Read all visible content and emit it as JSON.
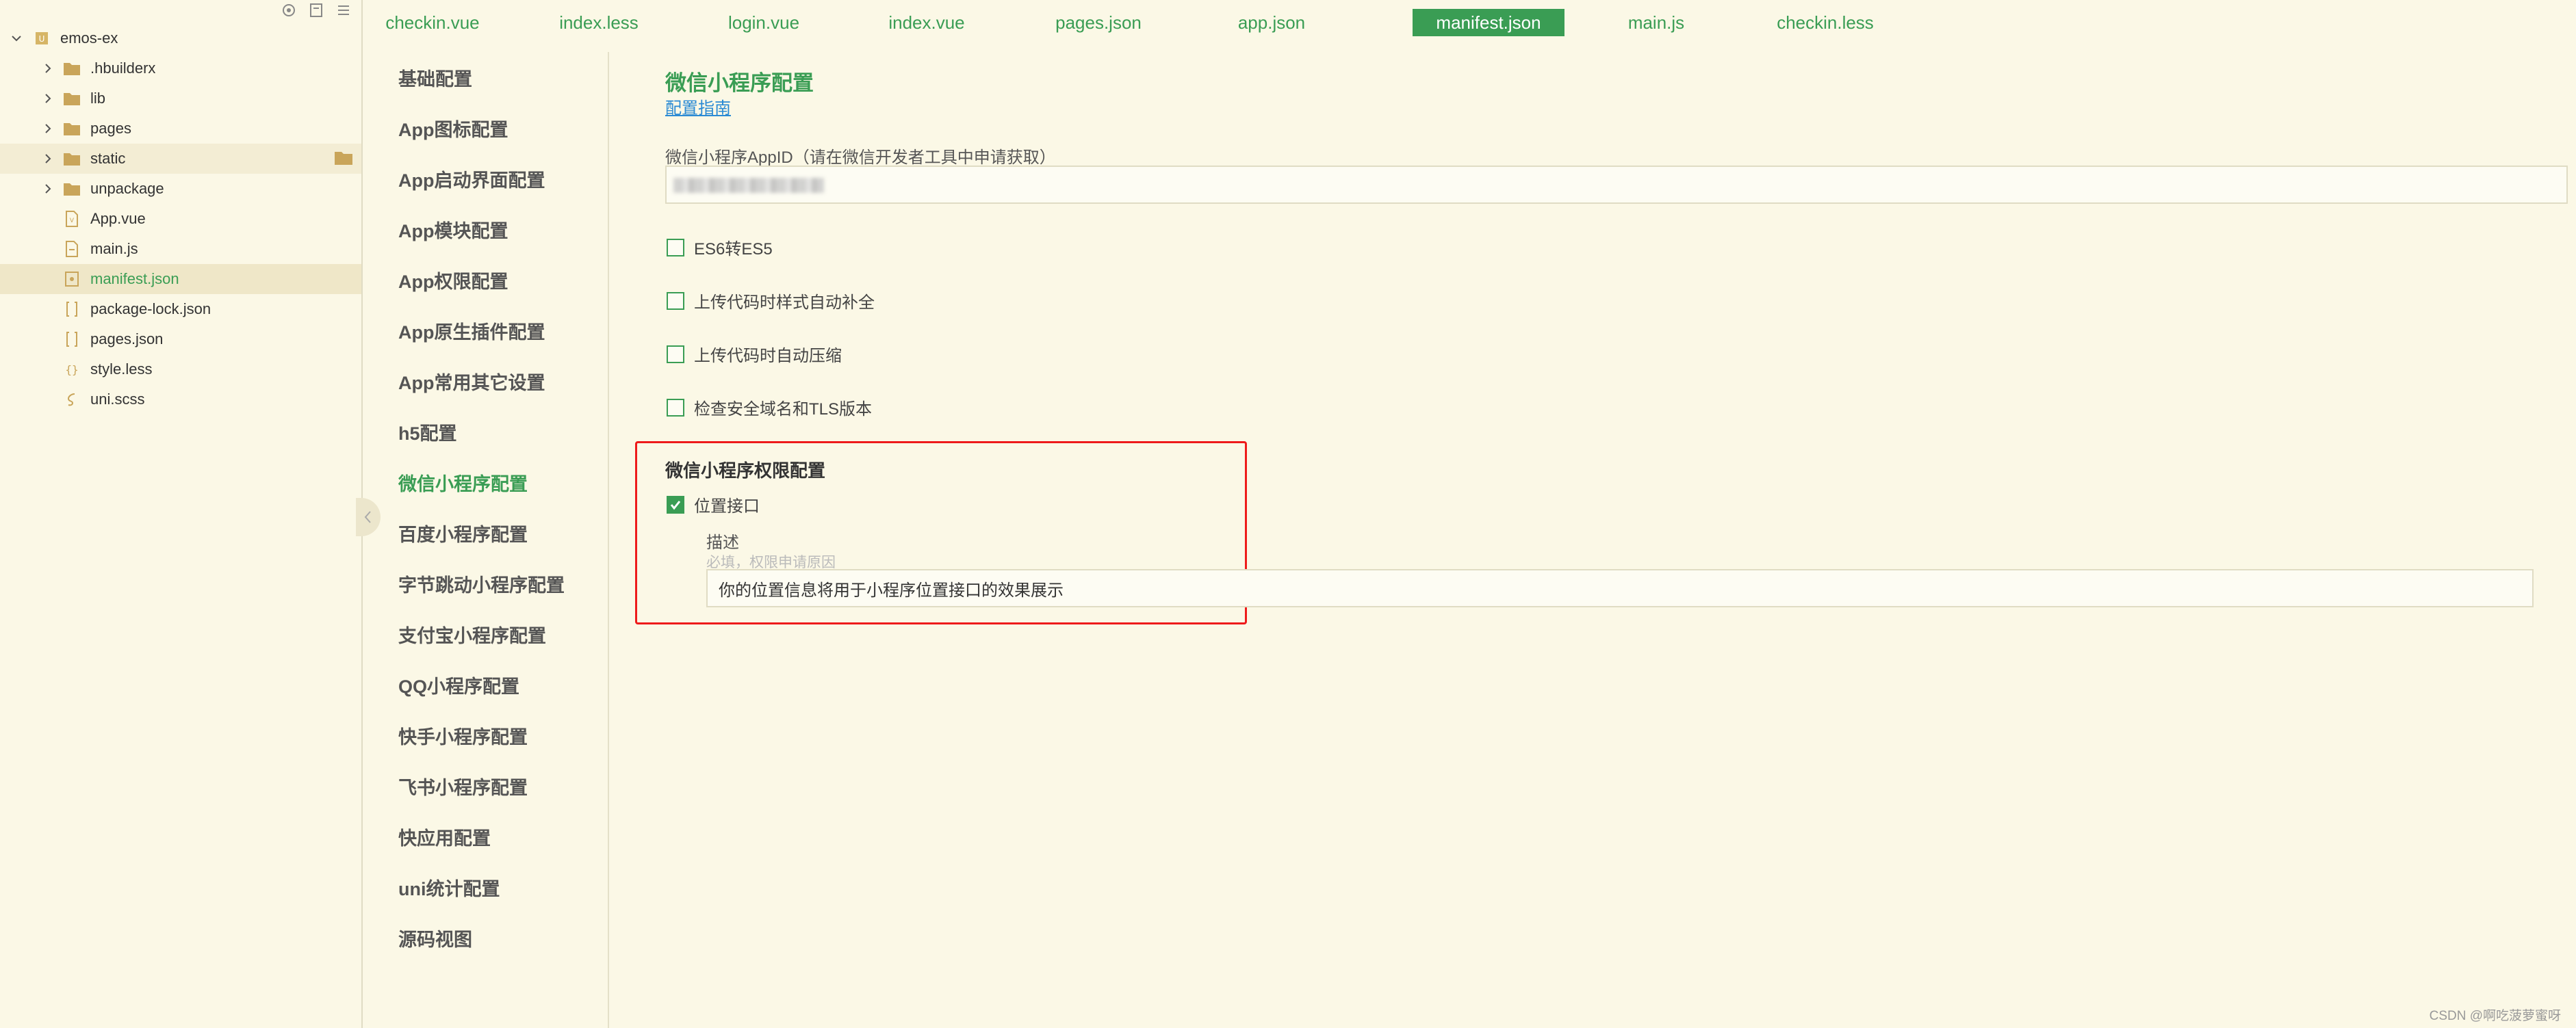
{
  "explorer": {
    "toolbar_icons": [
      "locate-icon",
      "new-file-icon",
      "menu-icon"
    ],
    "project": "emos-ex",
    "items": [
      {
        "label": ".hbuilderx",
        "type": "folder"
      },
      {
        "label": "lib",
        "type": "folder"
      },
      {
        "label": "pages",
        "type": "folder"
      },
      {
        "label": "static",
        "type": "folder"
      },
      {
        "label": "unpackage",
        "type": "folder"
      },
      {
        "label": "App.vue",
        "type": "vue"
      },
      {
        "label": "main.js",
        "type": "js"
      },
      {
        "label": "manifest.json",
        "type": "json",
        "active": true
      },
      {
        "label": "package-lock.json",
        "type": "json"
      },
      {
        "label": "pages.json",
        "type": "json"
      },
      {
        "label": "style.less",
        "type": "less"
      },
      {
        "label": "uni.scss",
        "type": "scss"
      }
    ]
  },
  "tabs": [
    "checkin.vue",
    "index.less",
    "login.vue",
    "index.vue",
    "pages.json",
    "app.json",
    "manifest.json",
    "main.js",
    "checkin.less"
  ],
  "active_tab": "manifest.json",
  "nav": {
    "items": [
      "基础配置",
      "App图标配置",
      "App启动界面配置",
      "App模块配置",
      "App权限配置",
      "App原生插件配置",
      "App常用其它设置",
      "h5配置",
      "微信小程序配置",
      "百度小程序配置",
      "字节跳动小程序配置",
      "支付宝小程序配置",
      "QQ小程序配置",
      "快手小程序配置",
      "飞书小程序配置",
      "快应用配置",
      "uni统计配置",
      "源码视图"
    ],
    "active": "微信小程序配置"
  },
  "content": {
    "title": "微信小程序配置",
    "guide_link": "配置指南",
    "appid_label": "微信小程序AppID（请在微信开发者工具中申请获取）",
    "options": [
      {
        "label": "ES6转ES5",
        "checked": false
      },
      {
        "label": "上传代码时样式自动补全",
        "checked": false
      },
      {
        "label": "上传代码时自动压缩",
        "checked": false
      },
      {
        "label": "检查安全域名和TLS版本",
        "checked": false
      }
    ],
    "permission": {
      "title": "微信小程序权限配置",
      "location_label": "位置接口",
      "location_checked": true,
      "desc_label": "描述",
      "desc_hint": "必填，权限申请原因",
      "desc_value": "你的位置信息将用于小程序位置接口的效果展示"
    }
  },
  "watermark": "CSDN @啊吃菠萝蜜呀",
  "colors": {
    "accent": "#3a9d54",
    "background": "#fbf8e6",
    "highlight_border": "#ee1b1b",
    "link": "#2a8ad4"
  }
}
